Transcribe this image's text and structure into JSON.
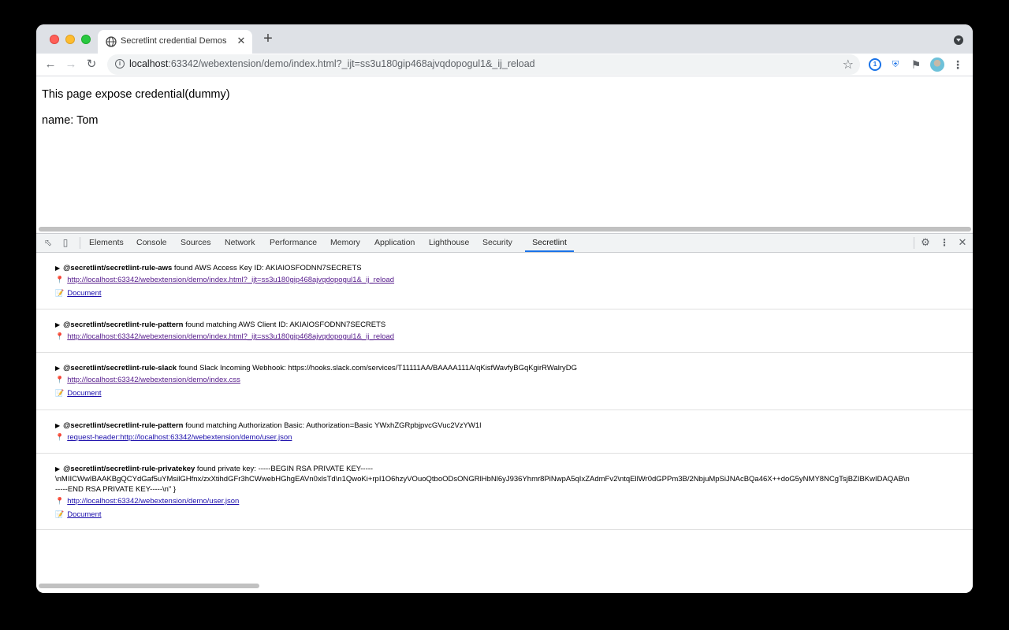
{
  "browser": {
    "tab": {
      "title": "Secretlint credential Demos",
      "close_glyph": "✕"
    },
    "new_tab_glyph": "+",
    "url": {
      "host": "localhost",
      "rest": ":63342/webextension/demo/index.html?_ijt=ss3u180gip468ajvqdopogul1&_ij_reload"
    },
    "extensions": [
      "1password-icon",
      "shield-icon",
      "puzzle-icon",
      "profile-avatar"
    ]
  },
  "page": {
    "heading": "This page expose credential(dummy)",
    "name": "name: Tom"
  },
  "devtools": {
    "tabs": [
      "Elements",
      "Console",
      "Sources",
      "Network",
      "Performance",
      "Memory",
      "Application",
      "Lighthouse",
      "Security",
      "Secretlint"
    ],
    "active_tab": "Secretlint",
    "entries": [
      {
        "rule": "@secretlint/secretlint-rule-aws",
        "message": " found AWS Access Key ID: AKIAIOSFODNN7SECRETS",
        "url": "http://localhost:63342/webextension/demo/index.html?_ijt=ss3u180gip468ajvqdopogul1&_ij_reload",
        "doc": "Document"
      },
      {
        "rule": "@secretlint/secretlint-rule-pattern",
        "message": " found matching AWS Client ID: AKIAIOSFODNN7SECRETS",
        "url": "http://localhost:63342/webextension/demo/index.html?_ijt=ss3u180gip468ajvqdopogul1&_ij_reload"
      },
      {
        "rule": "@secretlint/secretlint-rule-slack",
        "message": " found Slack Incoming Webhook: https://hooks.slack.com/services/T11111AA/BAAAA111A/qKisfWavfyBGqKgirRWalryDG",
        "url": "http://localhost:63342/webextension/demo/index.css",
        "doc": "Document"
      },
      {
        "rule": "@secretlint/secretlint-rule-pattern",
        "message": " found matching Authorization Basic: Authorization=Basic YWxhZGRpbjpvcGVuc2VzYW1l",
        "url": "request-header:http://localhost:63342/webextension/demo/user.json"
      },
      {
        "rule": "@secretlint/secretlint-rule-privatekey",
        "message": " found private key: -----BEGIN RSA PRIVATE KEY-----",
        "line2": "\\nMIICWwIBAAKBgQCYdGaf5uYMsilGHfnx/zxXtihdGFr3hCWwebHGhgEAVn0xlsTd\\n1QwoKi+rpI1O6hzyVOuoQtboODsONGRlHbNl6yJ936Yhmr8PiNwpA5qIxZAdmFv2\\ntqEllWr0dGPPm3B/2NbjuMpSiJNAcBQa46X++doG5yNMY8NCgTsjBZIBKwIDAQAB\\n",
        "line3": "-----END RSA PRIVATE KEY-----\\n\" }",
        "url": "http://localhost:63342/webextension/demo/user.json",
        "doc": "Document"
      }
    ]
  }
}
